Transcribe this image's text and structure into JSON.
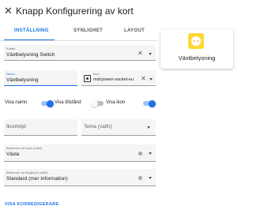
{
  "header": {
    "title": "Knapp Konfigurering av kort",
    "close_icon": "close-icon"
  },
  "tabs": [
    {
      "label": "INSTÄLLNING",
      "active": true
    },
    {
      "label": "SYNLIGHET",
      "active": false
    },
    {
      "label": "LAYOUT",
      "active": false
    }
  ],
  "entity": {
    "label": "Entitet",
    "value": "Växtbelysning Switch"
  },
  "name_field": {
    "label": "Namn",
    "value": "Växtbelysning"
  },
  "icon_field": {
    "label": "Ikon",
    "value": "mdi:power-socket-eu"
  },
  "toggles": [
    {
      "label": "Visa namn",
      "on": true
    },
    {
      "label": "Visa tillstånd",
      "on": false
    },
    {
      "label": "Visa ikon",
      "on": true
    }
  ],
  "icon_height": {
    "placeholder": "Ikonhöjd"
  },
  "theme": {
    "placeholder": "Tema (valfri)"
  },
  "tap_action": {
    "label": "Beteende vid tryck (valfri)",
    "value": "Växla"
  },
  "hold_action": {
    "label": "Beteende vid långtryck (valfri)",
    "value": "Standard (mer information)"
  },
  "preview": {
    "label": "Växtbelysning",
    "icon": "power-socket-icon",
    "icon_color": "#fdd835"
  },
  "code_editor_link": "VISA KODREDIGERARE",
  "accent_color": "#1a73e8"
}
